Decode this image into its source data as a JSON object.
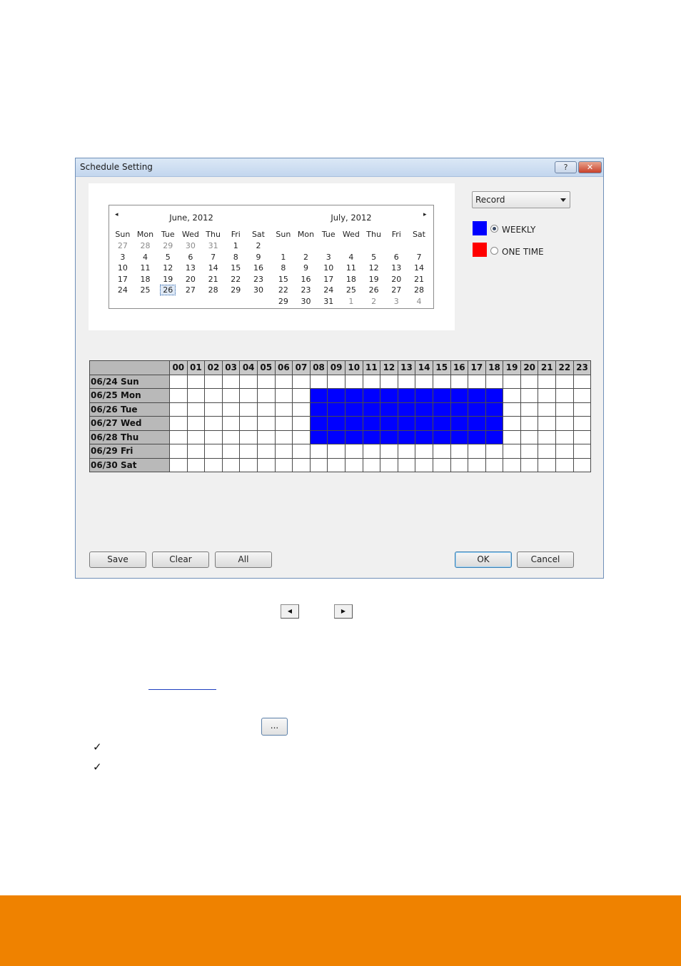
{
  "dialog": {
    "title": "Schedule Setting",
    "help_glyph": "?",
    "close_glyph": "✕"
  },
  "calendar": {
    "prev_glyph": "◂",
    "next_glyph": "▸",
    "months": [
      {
        "title": "June, 2012",
        "days_of_week": [
          "Sun",
          "Mon",
          "Tue",
          "Wed",
          "Thu",
          "Fri",
          "Sat"
        ],
        "weeks": [
          [
            "27",
            "28",
            "29",
            "30",
            "31",
            "1",
            "2"
          ],
          [
            "3",
            "4",
            "5",
            "6",
            "7",
            "8",
            "9"
          ],
          [
            "10",
            "11",
            "12",
            "13",
            "14",
            "15",
            "16"
          ],
          [
            "17",
            "18",
            "19",
            "20",
            "21",
            "22",
            "23"
          ],
          [
            "24",
            "25",
            "26",
            "27",
            "28",
            "29",
            "30"
          ],
          [
            "",
            "",
            "",
            "",
            "",
            "",
            ""
          ]
        ],
        "other_month_cells": [
          [
            0,
            0
          ],
          [
            0,
            1
          ],
          [
            0,
            2
          ],
          [
            0,
            3
          ],
          [
            0,
            4
          ]
        ],
        "selected_cell": [
          4,
          2
        ]
      },
      {
        "title": "July, 2012",
        "days_of_week": [
          "Sun",
          "Mon",
          "Tue",
          "Wed",
          "Thu",
          "Fri",
          "Sat"
        ],
        "weeks": [
          [
            "",
            "",
            "",
            "",
            "",
            "",
            ""
          ],
          [
            "1",
            "2",
            "3",
            "4",
            "5",
            "6",
            "7"
          ],
          [
            "8",
            "9",
            "10",
            "11",
            "12",
            "13",
            "14"
          ],
          [
            "15",
            "16",
            "17",
            "18",
            "19",
            "20",
            "21"
          ],
          [
            "22",
            "23",
            "24",
            "25",
            "26",
            "27",
            "28"
          ],
          [
            "29",
            "30",
            "31",
            "1",
            "2",
            "3",
            "4"
          ]
        ],
        "other_month_cells": [
          [
            5,
            3
          ],
          [
            5,
            4
          ],
          [
            5,
            5
          ],
          [
            5,
            6
          ]
        ],
        "selected_cell": null
      }
    ]
  },
  "controls": {
    "mode_value": "Record",
    "weekly_label": "WEEKLY",
    "onetime_label": "ONE TIME",
    "weekly_color": "#0000ff",
    "onetime_color": "#ff0000",
    "selected_mode": "weekly"
  },
  "schedule": {
    "hours": [
      "00",
      "01",
      "02",
      "03",
      "04",
      "05",
      "06",
      "07",
      "08",
      "09",
      "10",
      "11",
      "12",
      "13",
      "14",
      "15",
      "16",
      "17",
      "18",
      "19",
      "20",
      "21",
      "22",
      "23"
    ],
    "days": [
      "06/24 Sun",
      "06/25 Mon",
      "06/26 Tue",
      "06/27 Wed",
      "06/28 Thu",
      "06/29 Fri",
      "06/30 Sat"
    ],
    "active_hours": [
      [],
      [
        8,
        9,
        10,
        11,
        12,
        13,
        14,
        15,
        16,
        17,
        18
      ],
      [
        8,
        9,
        10,
        11,
        12,
        13,
        14,
        15,
        16,
        17,
        18
      ],
      [
        8,
        9,
        10,
        11,
        12,
        13,
        14,
        15,
        16,
        17,
        18
      ],
      [
        8,
        9,
        10,
        11,
        12,
        13,
        14,
        15,
        16,
        17,
        18
      ],
      [],
      []
    ],
    "active_color": "#0000ff"
  },
  "buttons": {
    "save": "Save",
    "clear": "Clear",
    "all": "All",
    "ok": "OK",
    "cancel": "Cancel"
  },
  "page": {
    "prev_month_glyph": "◀",
    "next_month_glyph": "▶",
    "browse_label": "...",
    "check_glyph": "✓",
    "footer_color": "#ef8200"
  }
}
